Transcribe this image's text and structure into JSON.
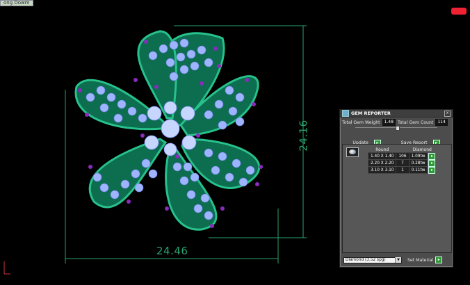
{
  "top_tab": "ong Dowm",
  "corner_badge": "",
  "dimensions": {
    "width": "24.46",
    "height": "24.16"
  },
  "panel": {
    "title": "GEM REPORTER",
    "close_glyph": "x",
    "total_gem_weight_label": "Total Gem Weight",
    "total_gem_weight_value": "1.48",
    "total_gem_count_label": "Total Gem Count",
    "total_gem_count_value": "114",
    "update_label": "Update",
    "save_report_label": "Save Report",
    "table": {
      "headers": [
        "Round",
        "",
        "Diamond"
      ],
      "rows": [
        {
          "size": "1.40 X 1.40",
          "count": "106",
          "weight": "1.09tw"
        },
        {
          "size": "2.20 X 2.20",
          "count": "7",
          "weight": "0.28tw"
        },
        {
          "size": "3.10 X 3.10",
          "count": "1",
          "weight": "0.11tw"
        }
      ]
    },
    "material_dropdown": "Diamond",
    "material_sg": "(3.52 spg)",
    "set_material_label": "Set Material"
  },
  "colors": {
    "metal": "#0f8a63",
    "gem": "#b8ccff",
    "accent": "#8a2bbd",
    "dimension_line": "#28a36f"
  }
}
